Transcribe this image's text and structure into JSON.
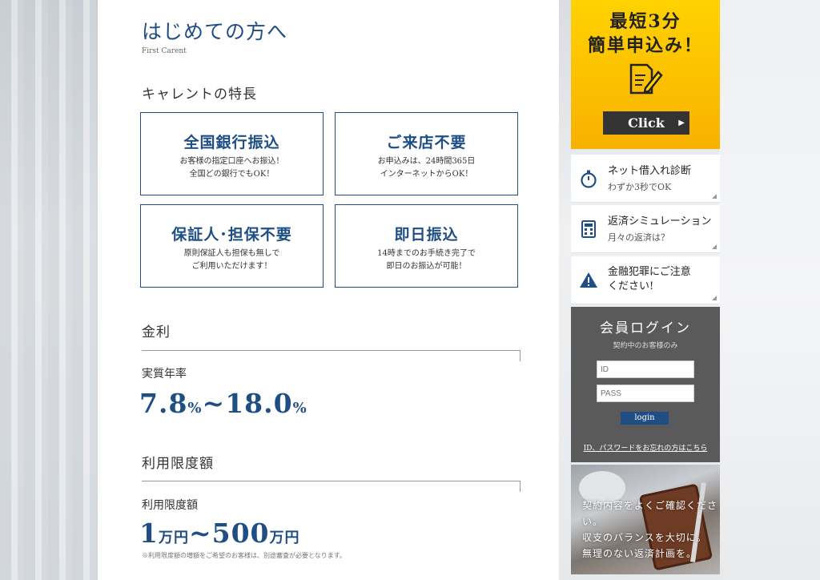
{
  "intro": {
    "title": "はじめての方へ",
    "subtitle": "First Carent"
  },
  "features": {
    "heading": "キャレントの特長",
    "items": [
      {
        "title": "全国銀行振込",
        "desc": "お客様の指定口座へお振込！\n全国どの銀行でもOK！"
      },
      {
        "title": "ご来店不要",
        "desc": "お申込みは、24時間365日\nインターネットからOK！"
      },
      {
        "title": "保証人･担保不要",
        "desc": "原則保証人も担保も無しで\nご利用いただけます！"
      },
      {
        "title": "即日振込",
        "desc": "14時までのお手続き完了で\n即日のお振込が可能！"
      }
    ]
  },
  "interest": {
    "heading": "金利",
    "label": "実質年率",
    "min": "7.8",
    "min_unit": "%",
    "sep": "~",
    "max": "18.0",
    "max_unit": "%"
  },
  "limit": {
    "heading": "利用限度額",
    "label": "利用限度額",
    "min": "1",
    "min_unit": "万円",
    "sep": "~",
    "max": "500",
    "max_unit": "万円",
    "note": "※利用限度額の増額をご希望のお客様は、別途審査が必要となります。"
  },
  "sidebar": {
    "apply": {
      "title": "最短3分\n簡単申込み！",
      "button": "Click",
      "icon": "form-pen-icon",
      "accent": "#ffc800"
    },
    "links": [
      {
        "title": "ネット借入れ診断",
        "sub": "わずか3秒でOK",
        "icon": "stopwatch-icon"
      },
      {
        "title": "返済シミュレーション",
        "sub": "月々の返済は？",
        "icon": "calculator-icon"
      },
      {
        "title": "金融犯罪にご注意\nください!",
        "sub": "",
        "icon": "warning-icon"
      }
    ],
    "login": {
      "title": "会員ログイン",
      "sub": "契約中のお客様のみ",
      "id_placeholder": "ID",
      "pass_placeholder": "PASS",
      "button": "login",
      "forgot": "ID、パスワードをお忘れの方はこちら"
    },
    "promo": {
      "text": "契約内容をよくご確認ください。\n収支のバランスを大切に。\n無理のない返済計画を。"
    }
  },
  "colors": {
    "brand_blue": "#1f4e84",
    "accent_yellow": "#ffc800",
    "login_bg": "#5a5a5a"
  }
}
